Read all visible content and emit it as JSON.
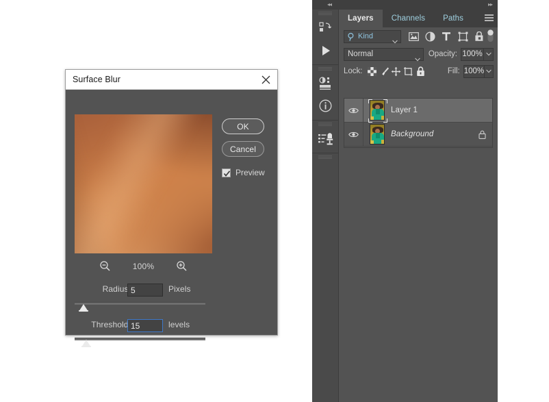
{
  "dialog": {
    "title": "Surface Blur",
    "close_icon": "close-icon",
    "zoom": {
      "out_icon": "zoom-out-icon",
      "value": "100%",
      "in_icon": "zoom-in-icon"
    },
    "radius": {
      "label": "Radius:",
      "value": "5",
      "unit": "Pixels",
      "slider_percent": 2
    },
    "threshold": {
      "label": "Threshold:",
      "value": "15",
      "unit": "levels",
      "slider_percent": 5,
      "focused": true
    },
    "ok_label": "OK",
    "cancel_label": "Cancel",
    "preview": {
      "label": "Preview",
      "checked": true,
      "check_icon": "checkmark-icon"
    }
  },
  "panel": {
    "collapse_left_icon": "double-chevron-left-icon",
    "collapse_right_icon": "double-chevron-right-icon",
    "rail": [
      {
        "name": "actions-icon",
        "group": 0
      },
      {
        "name": "play-icon",
        "group": 0
      },
      {
        "name": "adjustments-icon",
        "group": 1
      },
      {
        "name": "info-icon",
        "group": 1
      },
      {
        "name": "tool-presets-icon",
        "group": 2
      }
    ],
    "tabs": [
      {
        "label": "Layers",
        "active": true
      },
      {
        "label": "Channels",
        "active": false
      },
      {
        "label": "Paths",
        "active": false
      }
    ],
    "menu_icon": "panel-menu-icon",
    "filter": {
      "search_icon": "search-icon",
      "kind_label": "Kind",
      "caret_icon": "chevron-down-icon",
      "icons": [
        "pixel-layer-filter-icon",
        "adjustment-layer-filter-icon",
        "type-layer-filter-icon",
        "shape-layer-filter-icon",
        "smart-object-filter-icon"
      ],
      "toggle_icon": "filter-toggle-switch"
    },
    "blend": {
      "mode": "Normal",
      "caret_icon": "chevron-down-icon",
      "opacity_label": "Opacity:",
      "opacity_value": "100%",
      "opacity_caret_icon": "chevron-down-icon"
    },
    "lock": {
      "label": "Lock:",
      "icons": [
        "lock-transparent-pixels-icon",
        "lock-image-pixels-icon",
        "lock-position-icon",
        "lock-artboard-nesting-icon",
        "lock-all-icon"
      ],
      "fill_label": "Fill:",
      "fill_value": "100%",
      "fill_caret_icon": "chevron-down-icon"
    },
    "layers": [
      {
        "name": "Layer 1",
        "visible": true,
        "eye_icon": "eye-icon",
        "selected": true,
        "italic": false,
        "locked": false
      },
      {
        "name": "Background",
        "visible": true,
        "eye_icon": "eye-icon",
        "selected": false,
        "italic": true,
        "locked": true,
        "lock_icon": "lock-icon"
      }
    ]
  },
  "colors": {
    "panel_bg": "#535353",
    "panel_dark": "#3f3f3f",
    "rail_bg": "#4a4a4a",
    "selected_row": "#6b6b6b",
    "tab_link": "#9fd0e0",
    "focus_blue": "#3e78c8",
    "field_bg": "#484848",
    "titlebar_bg": "#ffffff"
  }
}
